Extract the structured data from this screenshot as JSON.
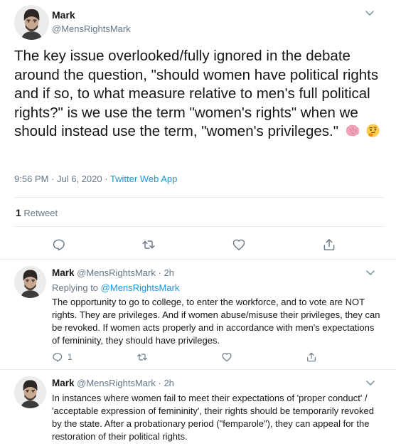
{
  "main_tweet": {
    "author_name": "Mark",
    "author_handle": "@MensRightsMark",
    "text": "The key issue overlooked/fully ignored in the debate around the question, \"should women have political rights and if so, to what measure relative to men's full political rights?\" is we use the term \"women's rights\" when we should instead use the term, \"women's privileges.\"",
    "emojis": [
      "brain-emoji",
      "thinking-face-emoji"
    ],
    "time": "9:56 PM",
    "date": "Jul 6, 2020",
    "separator": " · ",
    "source": "Twitter Web App",
    "retweet_count": "1",
    "retweet_label": "Retweet"
  },
  "replies": [
    {
      "author_name": "Mark",
      "author_handle": "@MensRightsMark",
      "time": "· 2h",
      "replying_prefix": "Replying to",
      "replying_to": "@MensRightsMark",
      "text": "The opportunity to go to college, to enter the workforce, and to vote are NOT rights. They are privileges. And if women abuse/misuse their privileges, they can be revoked. If women acts properly and in accordance with men's expectations of femininity, they should have privileges.",
      "reply_count": "1"
    },
    {
      "author_name": "Mark",
      "author_handle": "@MensRightsMark",
      "time": "· 2h",
      "text": "In instances where women fail to meet their expectations of 'proper conduct' / 'acceptable expression of femininity', their rights should be temporarily revoked by the state. After a probationary period (\"femparole\"), they can appeal for the restoration of their political rights."
    }
  ],
  "colors": {
    "text": "#14171a",
    "secondary": "#657786",
    "link": "#1b95e0",
    "divider": "#e6ecf0"
  }
}
